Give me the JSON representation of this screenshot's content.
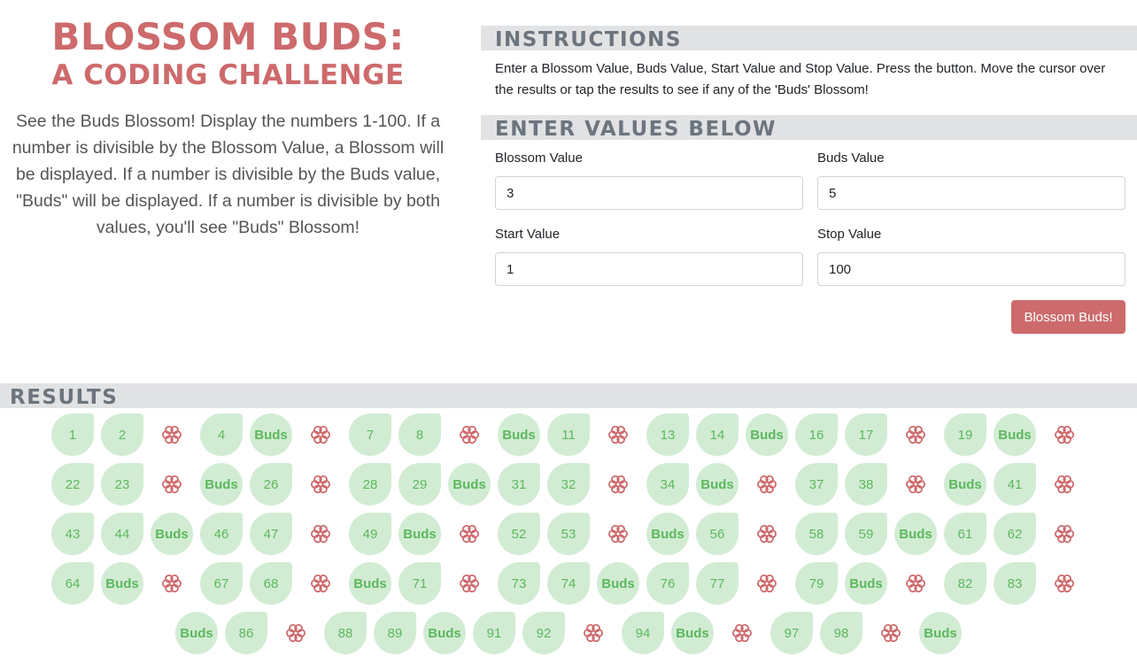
{
  "header": {
    "title_line1": "BLOSSOM BUDS:",
    "title_line2": "A CODING CHALLENGE",
    "intro": "See the Buds Blossom! Display the numbers 1-100. If a number is divisible by the Blossom Value, a Blossom will be displayed. If a number is divisible by the Buds value, \"Buds\" will be displayed. If a number is divisible by both values, you'll see \"Buds\" Blossom!"
  },
  "instructions": {
    "heading": "INSTRUCTIONS",
    "text": "Enter a Blossom Value, Buds Value, Start Value and Stop Value. Press the button. Move the cursor over the results or tap the results to see if any of the 'Buds' Blossom!"
  },
  "form": {
    "heading": "ENTER VALUES BELOW",
    "blossom_label": "Blossom Value",
    "blossom_value": "3",
    "buds_label": "Buds Value",
    "buds_value": "5",
    "start_label": "Start Value",
    "start_value": "1",
    "stop_label": "Stop Value",
    "stop_value": "100",
    "button_label": "Blossom Buds!"
  },
  "results": {
    "heading": "RESULTS",
    "blossom_icon": "flower-icon",
    "buds_label": "Buds",
    "items": [
      "1",
      "2",
      "blossom",
      "4",
      "Buds",
      "blossom",
      "7",
      "8",
      "blossom",
      "Buds",
      "11",
      "blossom",
      "13",
      "14",
      "Buds",
      "16",
      "17",
      "blossom",
      "19",
      "Buds",
      "blossom",
      "22",
      "23",
      "blossom",
      "Buds",
      "26",
      "blossom",
      "28",
      "29",
      "Buds",
      "31",
      "32",
      "blossom",
      "34",
      "Buds",
      "blossom",
      "37",
      "38",
      "blossom",
      "Buds",
      "41",
      "blossom",
      "43",
      "44",
      "Buds",
      "46",
      "47",
      "blossom",
      "49",
      "Buds",
      "blossom",
      "52",
      "53",
      "blossom",
      "Buds",
      "56",
      "blossom",
      "58",
      "59",
      "Buds",
      "61",
      "62",
      "blossom",
      "64",
      "Buds",
      "blossom",
      "67",
      "68",
      "blossom",
      "Buds",
      "71",
      "blossom",
      "73",
      "74",
      "Buds",
      "76",
      "77",
      "blossom",
      "79",
      "Buds",
      "blossom",
      "82",
      "83",
      "blossom",
      "Buds",
      "86",
      "blossom",
      "88",
      "89",
      "Buds",
      "91",
      "92",
      "blossom",
      "94",
      "Buds",
      "blossom",
      "97",
      "98",
      "blossom",
      "Buds"
    ]
  },
  "colors": {
    "accent": "#cd6a6c",
    "result_text": "#5cb85c",
    "result_bg": "#d2ecd4",
    "section_bar": "#e1e2e4"
  }
}
